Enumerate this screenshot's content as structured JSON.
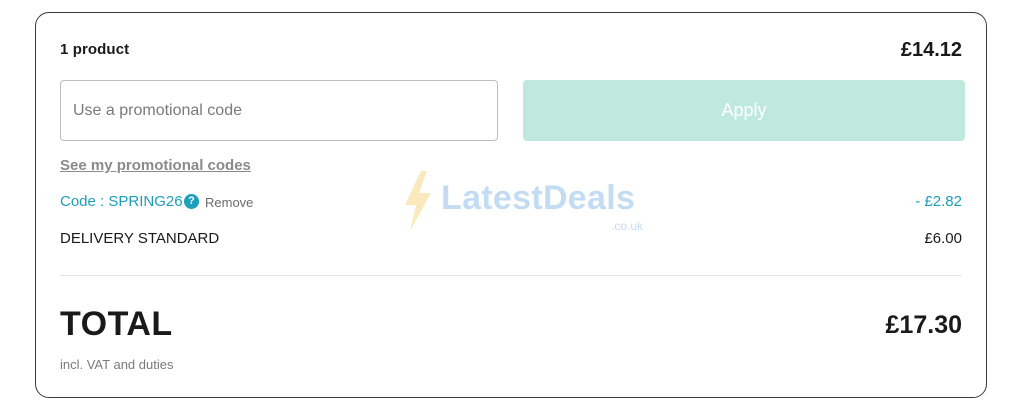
{
  "summary": {
    "product_count": "1 product",
    "subtotal": "£14.12"
  },
  "promo": {
    "placeholder": "Use a promotional code",
    "value": "",
    "apply_label": "Apply",
    "see_codes_label": "See my promotional codes",
    "applied_code_label": "Code : SPRING26",
    "remove_label": "Remove",
    "discount": "- £2.82"
  },
  "delivery": {
    "label": "DELIVERY STANDARD",
    "price": "£6.00"
  },
  "total": {
    "label": "TOTAL",
    "value": "£17.30",
    "vat_note": "incl. VAT and duties"
  },
  "watermark": {
    "brand": "LatestDeals",
    "domain": ".co.uk"
  },
  "icons": {
    "help": "help-circle-icon",
    "bolt": "lightning-bolt-icon"
  },
  "colors": {
    "accent": "#1c9fb8",
    "apply_button_bg": "#bfe9df",
    "border": "#3a3a3a"
  }
}
